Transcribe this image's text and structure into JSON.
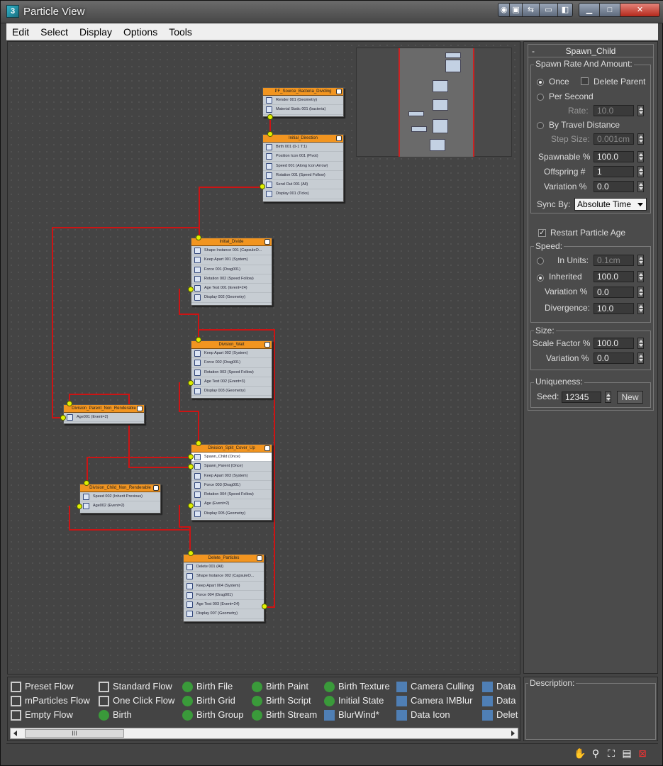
{
  "window": {
    "title": "Particle View",
    "controls": {
      "minimize": "▁",
      "maximize": "□",
      "close": "✕"
    }
  },
  "menu": [
    "Edit",
    "Select",
    "Display",
    "Options",
    "Tools"
  ],
  "nodes": [
    {
      "id": "n1",
      "title": "PF_Source_Bacteria_Dividing",
      "ops": [
        "Render 001 (Geometry)",
        "Material Static 001 (bacteria)"
      ]
    },
    {
      "id": "n2",
      "title": "Initial_Direction",
      "ops": [
        "Birth 001 (0-1 T:1)",
        "Position Icon 001 (Pivot)",
        "Speed 001 (Along Icon Arrow)",
        "Rotation 001 (Speed Follow)",
        "Send Out 001 (All)",
        "Display 001 (Ticks)"
      ]
    },
    {
      "id": "n3",
      "title": "Initial_Divide",
      "ops": [
        "Shape Instance 001 (CapsuleO...",
        "Keep Apart 001 (System)",
        "Force 001 (Drag001)",
        "Rotation 002 (Speed Follow)",
        "Age Test 001 (Event=24)",
        "Display 002 (Geometry)"
      ]
    },
    {
      "id": "n4",
      "title": "Division_Wait",
      "ops": [
        "Keep Apart 002 (System)",
        "Force 002 (Drag001)",
        "Rotation 003 (Speed Follow)",
        "Age Test 002 (Event=3)",
        "Display 003 (Geometry)"
      ]
    },
    {
      "id": "n5",
      "title": "Division_Parent_Non_Renderable",
      "ops": [
        "Age001 (Event=2)"
      ]
    },
    {
      "id": "n6",
      "title": "Division_Split_Cover_Up",
      "ops": [
        "Spawn_Child (Once)",
        "Spawn_Parent (Once)",
        "Keep Apart 003 (System)",
        "Force 003 (Drag001)",
        "Rotation 004 (Speed Follow)",
        "Age (Event=2)",
        "Display 005 (Geometry)"
      ]
    },
    {
      "id": "n7",
      "title": "Division_Child_Non_Renderable",
      "ops": [
        "Speed 002 (Inherit Previous)",
        "Age002 (Event=2)"
      ]
    },
    {
      "id": "n8",
      "title": "Delete_Particles",
      "ops": [
        "Delete 001 (All)",
        "Shape Instance 002 (CapsuleO...",
        "Keep Apart 004 (System)",
        "Force 004 (Drag001)",
        "Age Test 003 (Event=24)",
        "Display 007 (Geometry)"
      ]
    }
  ],
  "panel": {
    "rollout_title": "Spawn_Child",
    "collapse_glyph": "-",
    "spawn_group": "Spawn Rate And Amount:",
    "once": "Once",
    "delete_parent": "Delete Parent",
    "per_second": "Per Second",
    "rate_label": "Rate:",
    "rate_value": "10.0",
    "by_travel": "By Travel Distance",
    "step_label": "Step Size:",
    "step_value": "0.001cm",
    "spawnable_label": "Spawnable %",
    "spawnable_value": "100.0",
    "offspring_label": "Offspring #",
    "offspring_value": "1",
    "variation1_label": "Variation %",
    "variation1_value": "0.0",
    "sync_label": "Sync By:",
    "sync_value": "Absolute Time",
    "restart_age": "Restart Particle Age",
    "speed_group": "Speed:",
    "in_units": "In Units:",
    "in_units_value": "0.1cm",
    "inherited": "Inherited",
    "inherited_value": "100.0",
    "variation2_label": "Variation %",
    "variation2_value": "0.0",
    "divergence_label": "Divergence:",
    "divergence_value": "10.0",
    "size_group": "Size:",
    "scale_label": "Scale Factor %",
    "scale_value": "100.0",
    "variation3_label": "Variation %",
    "variation3_value": "0.0",
    "unique_group": "Uniqueness:",
    "seed_label": "Seed:",
    "seed_value": "12345",
    "new_button": "New"
  },
  "depot": {
    "col1": [
      "Preset Flow",
      "mParticles Flow",
      "Empty Flow"
    ],
    "col2": [
      "Standard Flow",
      "One Click Flow",
      "Birth"
    ],
    "col3": [
      "Birth File",
      "Birth Grid",
      "Birth Group"
    ],
    "col4": [
      "Birth Paint",
      "Birth Script",
      "Birth Stream"
    ],
    "col5": [
      "Birth Texture",
      "Initial State",
      "BlurWind*"
    ],
    "col6": [
      "Camera Culling",
      "Camera IMBlur",
      "Data Icon"
    ],
    "col7": [
      "Data",
      "Data",
      "Delet"
    ],
    "scroll_thumb": "III"
  },
  "description_label": "Description:",
  "colors": {
    "accent": "#f29520",
    "wire": "#cc1414",
    "port": "#e0f000"
  }
}
